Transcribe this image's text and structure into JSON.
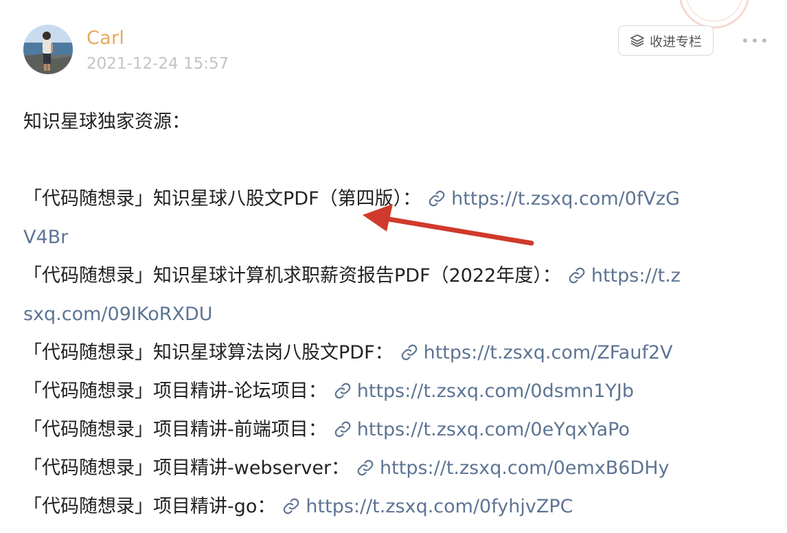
{
  "author": {
    "name": "Carl",
    "timestamp": "2021-12-24 15:57"
  },
  "toolbar": {
    "save_label": "收进专栏",
    "save_icon": "layers-icon",
    "more_icon": "more-dots-icon"
  },
  "post": {
    "heading": "知识星球独家资源：",
    "resources": [
      {
        "prefix": "「代码随想录」知识星球八股文PDF（第四版）：",
        "url_part1": "https://t.zsxq.com/0fVzG",
        "url_part2": "V4Br"
      },
      {
        "prefix": "「代码随想录」知识星球计算机求职薪资报告PDF（2022年度）：",
        "url_part1": "https://t.z",
        "url_part2": "sxq.com/09IKoRXDU"
      },
      {
        "prefix": "「代码随想录」知识星球算法岗八股文PDF：",
        "url_part1": "https://t.zsxq.com/ZFauf2V"
      },
      {
        "prefix": "「代码随想录」项目精讲-论坛项目：",
        "url_part1": "https://t.zsxq.com/0dsmn1YJb"
      },
      {
        "prefix": "「代码随想录」项目精讲-前端项目：",
        "url_part1": "https://t.zsxq.com/0eYqxYaPo"
      },
      {
        "prefix": "「代码随想录」项目精讲-webserver：",
        "url_part1": "https://t.zsxq.com/0emxB6DHy"
      },
      {
        "prefix": "「代码随想录」项目精讲-go：",
        "url_part1": "https://t.zsxq.com/0fyhjvZPC"
      }
    ]
  },
  "colors": {
    "author": "#e8a85d",
    "link": "#5d7493",
    "arrow": "#cf3a2c",
    "timestamp": "#c4c4c4"
  }
}
